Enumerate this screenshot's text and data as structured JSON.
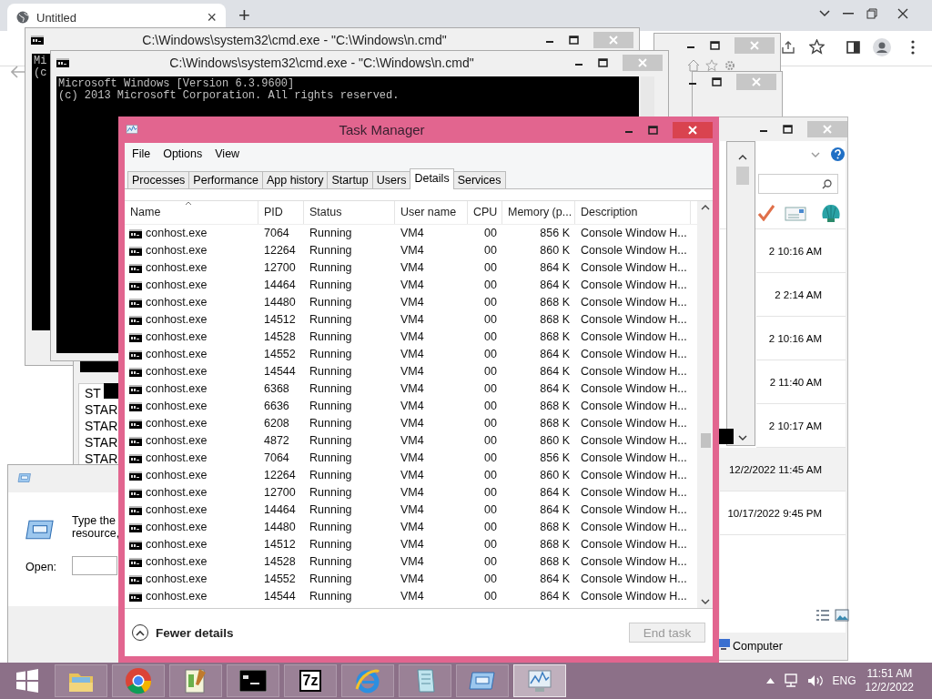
{
  "browser": {
    "tab_title": "Untitled",
    "close_tab": "×",
    "new_tab": "+"
  },
  "cmd_back": {
    "title": "C:\\Windows\\system32\\cmd.exe - \"C:\\Windows\\n.cmd\"",
    "lines": [
      "Mi",
      "(c"
    ]
  },
  "cmd_front": {
    "title": "C:\\Windows\\system32\\cmd.exe - \"C:\\Windows\\n.cmd\"",
    "lines": [
      "Microsoft Windows [Version 6.3.9600]",
      "(c) 2013 Microsoft Corporation. All rights reserved."
    ]
  },
  "log_window": {
    "lines": [
      "ST",
      "STAR",
      "STAR",
      "STAR",
      "STAR"
    ]
  },
  "run_dialog": {
    "prompt_lines": [
      "Type the",
      "resource,"
    ],
    "open_label": "Open:"
  },
  "explorer": {
    "dates": [
      {
        "text": "2 10:16 AM",
        "selected": false
      },
      {
        "text": "2 2:14 AM",
        "selected": false
      },
      {
        "text": "2 10:16 AM",
        "selected": false
      },
      {
        "text": "2 11:40 AM",
        "selected": false
      },
      {
        "text": "2 10:17 AM",
        "selected": false
      },
      {
        "text": "12/2/2022 11:45 AM",
        "selected": true
      },
      {
        "text": "10/17/2022 9:45 PM",
        "selected": false
      }
    ],
    "status": "Computer"
  },
  "task_manager": {
    "title": "Task Manager",
    "menu": [
      "File",
      "Options",
      "View"
    ],
    "tabs": [
      {
        "label": "Processes",
        "selected": false
      },
      {
        "label": "Performance",
        "selected": false
      },
      {
        "label": "App history",
        "selected": false
      },
      {
        "label": "Startup",
        "selected": false
      },
      {
        "label": "Users",
        "selected": false
      },
      {
        "label": "Details",
        "selected": true
      },
      {
        "label": "Services",
        "selected": false
      }
    ],
    "columns": [
      {
        "label": "Name",
        "kind": "text",
        "sorted": true
      },
      {
        "label": "PID",
        "kind": "text",
        "sorted": false
      },
      {
        "label": "Status",
        "kind": "text",
        "sorted": false
      },
      {
        "label": "User name",
        "kind": "text",
        "sorted": false
      },
      {
        "label": "CPU",
        "kind": "number",
        "sorted": false
      },
      {
        "label": "Memory (p...",
        "kind": "number",
        "sorted": false
      },
      {
        "label": "Description",
        "kind": "text",
        "sorted": false
      }
    ],
    "rows": [
      [
        "conhost.exe",
        "7064",
        "Running",
        "VM4",
        "00",
        "856 K",
        "Console Window H..."
      ],
      [
        "conhost.exe",
        "12264",
        "Running",
        "VM4",
        "00",
        "860 K",
        "Console Window H..."
      ],
      [
        "conhost.exe",
        "12700",
        "Running",
        "VM4",
        "00",
        "864 K",
        "Console Window H..."
      ],
      [
        "conhost.exe",
        "14464",
        "Running",
        "VM4",
        "00",
        "864 K",
        "Console Window H..."
      ],
      [
        "conhost.exe",
        "14480",
        "Running",
        "VM4",
        "00",
        "868 K",
        "Console Window H..."
      ],
      [
        "conhost.exe",
        "14512",
        "Running",
        "VM4",
        "00",
        "868 K",
        "Console Window H..."
      ],
      [
        "conhost.exe",
        "14528",
        "Running",
        "VM4",
        "00",
        "868 K",
        "Console Window H..."
      ],
      [
        "conhost.exe",
        "14552",
        "Running",
        "VM4",
        "00",
        "864 K",
        "Console Window H..."
      ],
      [
        "conhost.exe",
        "14544",
        "Running",
        "VM4",
        "00",
        "864 K",
        "Console Window H..."
      ],
      [
        "conhost.exe",
        "6368",
        "Running",
        "VM4",
        "00",
        "864 K",
        "Console Window H..."
      ],
      [
        "conhost.exe",
        "6636",
        "Running",
        "VM4",
        "00",
        "868 K",
        "Console Window H..."
      ],
      [
        "conhost.exe",
        "6208",
        "Running",
        "VM4",
        "00",
        "868 K",
        "Console Window H..."
      ],
      [
        "conhost.exe",
        "4872",
        "Running",
        "VM4",
        "00",
        "860 K",
        "Console Window H..."
      ],
      [
        "conhost.exe",
        "7064",
        "Running",
        "VM4",
        "00",
        "856 K",
        "Console Window H..."
      ],
      [
        "conhost.exe",
        "12264",
        "Running",
        "VM4",
        "00",
        "860 K",
        "Console Window H..."
      ],
      [
        "conhost.exe",
        "12700",
        "Running",
        "VM4",
        "00",
        "864 K",
        "Console Window H..."
      ],
      [
        "conhost.exe",
        "14464",
        "Running",
        "VM4",
        "00",
        "864 K",
        "Console Window H..."
      ],
      [
        "conhost.exe",
        "14480",
        "Running",
        "VM4",
        "00",
        "868 K",
        "Console Window H..."
      ],
      [
        "conhost.exe",
        "14512",
        "Running",
        "VM4",
        "00",
        "868 K",
        "Console Window H..."
      ],
      [
        "conhost.exe",
        "14528",
        "Running",
        "VM4",
        "00",
        "868 K",
        "Console Window H..."
      ],
      [
        "conhost.exe",
        "14552",
        "Running",
        "VM4",
        "00",
        "864 K",
        "Console Window H..."
      ],
      [
        "conhost.exe",
        "14544",
        "Running",
        "VM4",
        "00",
        "864 K",
        "Console Window H..."
      ]
    ],
    "fewer_details": "Fewer details",
    "end_task": {
      "label": "End task",
      "disabled": true
    }
  },
  "taskbar": {
    "apps": [
      {
        "kind": "folder",
        "active": false
      },
      {
        "kind": "chrome",
        "active": false
      },
      {
        "kind": "notepadpp",
        "active": false
      },
      {
        "kind": "console",
        "active": false
      },
      {
        "kind": "archiver",
        "active": false,
        "label": "7z"
      },
      {
        "kind": "ie",
        "active": false
      },
      {
        "kind": "notepad",
        "active": false
      },
      {
        "kind": "run",
        "active": false
      },
      {
        "kind": "taskmgr",
        "active": true
      }
    ],
    "language": "ENG",
    "time": "11:51 AM",
    "date": "12/2/2022"
  }
}
